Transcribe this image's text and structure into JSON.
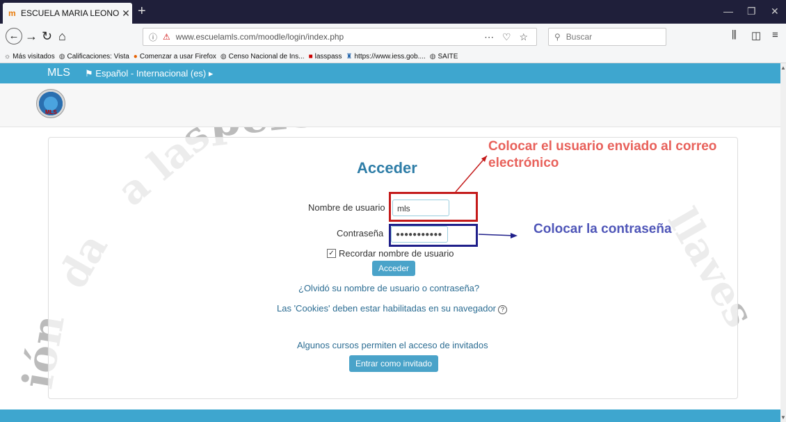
{
  "browser": {
    "tab_title": "ESCUELA MARIA LEONOR SAL",
    "url": "www.escuelamls.com/moodle/login/index.php",
    "search_placeholder": "Buscar",
    "bookmarks": [
      {
        "label": "Más visitados",
        "icon": "gear-icon"
      },
      {
        "label": "Calificaciones: Vista",
        "icon": "globe-icon"
      },
      {
        "label": "Comenzar a usar Firefox",
        "icon": "firefox-icon"
      },
      {
        "label": "Censo Nacional de Ins...",
        "icon": "globe-icon"
      },
      {
        "label": "lasspass",
        "icon": "lastpass-icon"
      },
      {
        "label": "https://www.iess.gob....",
        "icon": "iess-icon"
      },
      {
        "label": "SAITE",
        "icon": "globe-icon"
      }
    ]
  },
  "site": {
    "brand": "MLS",
    "language": "Español - Internacional (es) ▸",
    "logo_text": "MLS"
  },
  "background_text": {
    "top": "personas",
    "left1": "a las",
    "left2": "da",
    "left3": "ión",
    "right": "llaves"
  },
  "login": {
    "title": "Acceder",
    "username_label": "Nombre de usuario",
    "username_value": "mls",
    "password_label": "Contraseña",
    "password_value": "●●●●●●●●●●●",
    "remember_label": "Recordar nombre de usuario",
    "submit_label": "Acceder",
    "forgot_link": "¿Olvidó su nombre de usuario o contraseña?",
    "cookies_text": "Las 'Cookies' deben estar habilitadas en su navegador",
    "guest_text": "Algunos cursos permiten el acceso de invitados",
    "guest_button": "Entrar como invitado"
  },
  "annotations": {
    "username_note_line1": "Colocar el usuario enviado al correo",
    "username_note_line2": "electrónico",
    "password_note": "Colocar la contraseña",
    "red": "#c41a1a",
    "blue": "#1f1f8a"
  },
  "colors": {
    "accent": "#3ea6cf",
    "title": "#2e7da7"
  }
}
